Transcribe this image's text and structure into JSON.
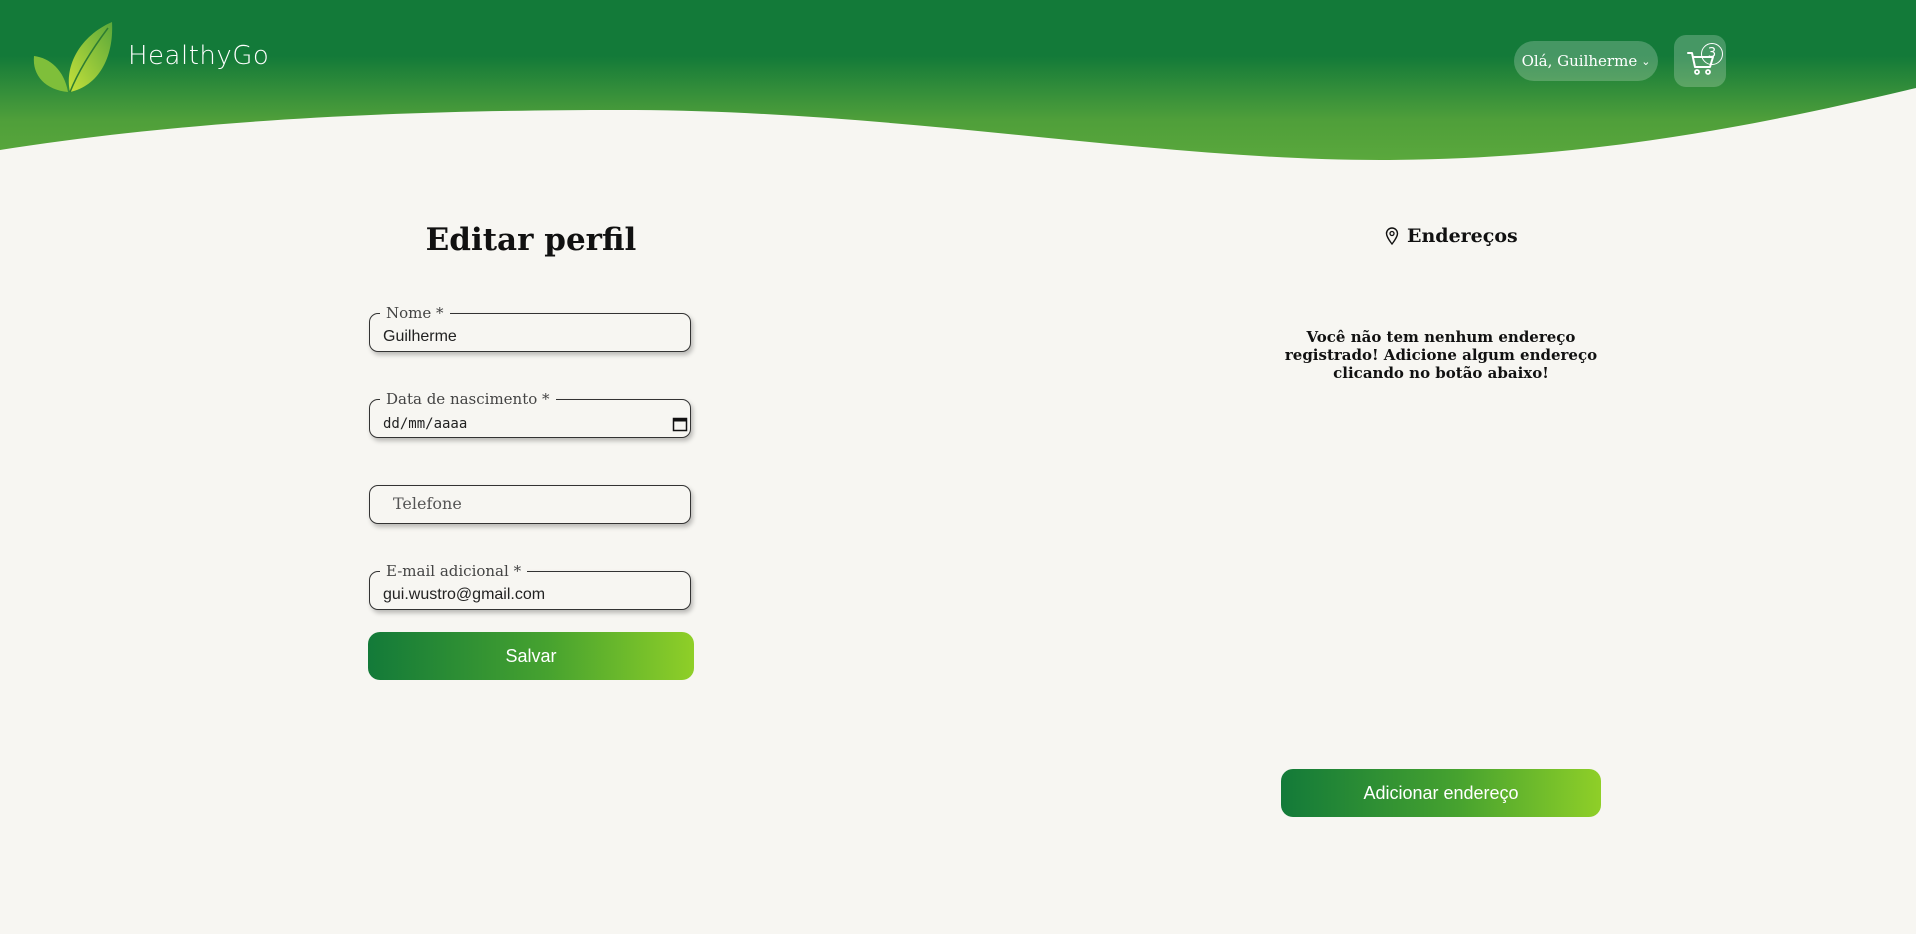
{
  "header": {
    "brand": "HealthyGo",
    "user_greeting": "Olá, Guilherme",
    "cart_count": "3",
    "colors": {
      "dark_green": "#137a39",
      "light_green": "#8fcf28"
    }
  },
  "profile": {
    "title": "Editar perfil",
    "fields": {
      "name": {
        "label": "Nome *",
        "value": "Guilherme"
      },
      "birthdate": {
        "label": "Data de nascimento *",
        "value": "dd/mm/aaaa"
      },
      "phone": {
        "placeholder": "Telefone"
      },
      "email": {
        "label": "E-mail adicional *",
        "value": "gui.wustro@gmail.com"
      }
    },
    "save_label": "Salvar"
  },
  "addresses": {
    "title": "Endereços",
    "empty_message": "Você não tem nenhum endereço registrado! Adicione algum endereço clicando no botão abaixo!",
    "add_label": "Adicionar endereço"
  }
}
